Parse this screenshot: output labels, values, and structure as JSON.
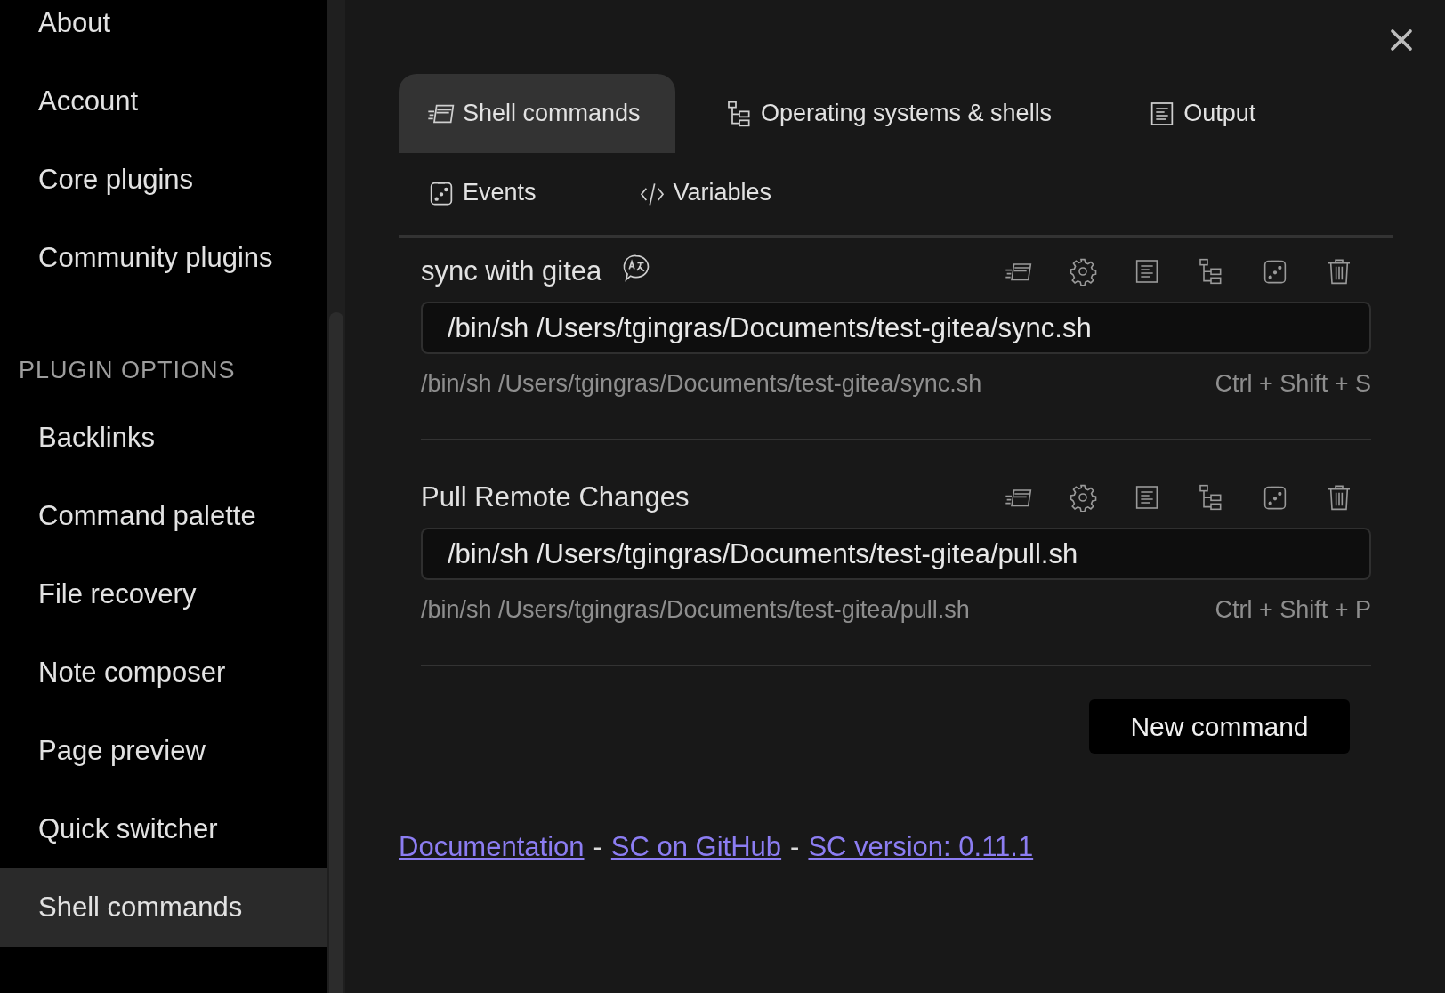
{
  "sidebar": {
    "items": [
      {
        "label": "About",
        "selected": false
      },
      {
        "label": "Account",
        "selected": false
      },
      {
        "label": "Core plugins",
        "selected": false
      },
      {
        "label": "Community plugins",
        "selected": false
      }
    ],
    "section_heading": "PLUGIN OPTIONS",
    "plugin_items": [
      {
        "label": "Backlinks",
        "selected": false
      },
      {
        "label": "Command palette",
        "selected": false
      },
      {
        "label": "File recovery",
        "selected": false
      },
      {
        "label": "Note composer",
        "selected": false
      },
      {
        "label": "Page preview",
        "selected": false
      },
      {
        "label": "Quick switcher",
        "selected": false
      },
      {
        "label": "Shell commands",
        "selected": true
      }
    ]
  },
  "tabs": [
    {
      "label": "Shell commands",
      "selected": true
    },
    {
      "label": "Operating systems & shells",
      "selected": false
    },
    {
      "label": "Output",
      "selected": false
    },
    {
      "label": "Events",
      "selected": false
    },
    {
      "label": "Variables",
      "selected": false
    }
  ],
  "commands": [
    {
      "name": "sync with gitea",
      "alias_icon": true,
      "value": "/bin/sh /Users/tgingras/Documents/test-gitea/sync.sh",
      "description": "/bin/sh /Users/tgingras/Documents/test-gitea/sync.sh",
      "hotkey": "Ctrl + Shift + S"
    },
    {
      "name": "Pull Remote Changes",
      "alias_icon": false,
      "value": "/bin/sh /Users/tgingras/Documents/test-gitea/pull.sh",
      "description": "/bin/sh /Users/tgingras/Documents/test-gitea/pull.sh",
      "hotkey": "Ctrl + Shift + P"
    }
  ],
  "new_command_button": "New command",
  "footer_links": [
    {
      "label": "Documentation"
    },
    {
      "label": "SC on GitHub"
    },
    {
      "label": "SC version: 0.11.1"
    }
  ],
  "footer_separator": "-"
}
